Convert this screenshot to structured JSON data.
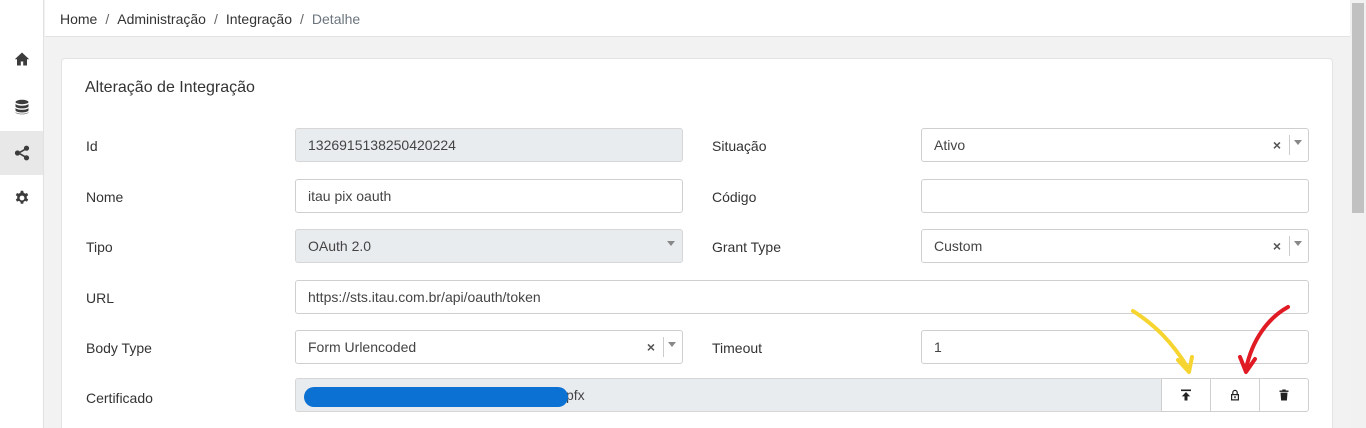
{
  "breadcrumb": {
    "home": "Home",
    "admin": "Administração",
    "integration": "Integração",
    "current": "Detalhe",
    "separator": "/"
  },
  "sidebar": {
    "items": [
      {
        "icon": "home-icon"
      },
      {
        "icon": "database-icon"
      },
      {
        "icon": "share-icon",
        "active": true
      },
      {
        "icon": "gear-icon"
      }
    ]
  },
  "form": {
    "title": "Alteração de Integração",
    "id": {
      "label": "Id",
      "value": "1326915138250420224"
    },
    "situacao": {
      "label": "Situação",
      "value": "Ativo",
      "clear": "×"
    },
    "nome": {
      "label": "Nome",
      "value": "itau pix oauth"
    },
    "codigo": {
      "label": "Código",
      "value": ""
    },
    "tipo": {
      "label": "Tipo",
      "value": "OAuth 2.0"
    },
    "grant_type": {
      "label": "Grant Type",
      "value": "Custom",
      "clear": "×"
    },
    "url": {
      "label": "URL",
      "value": "https://sts.itau.com.br/api/oauth/token"
    },
    "body_type": {
      "label": "Body Type",
      "value": "Form Urlencoded",
      "clear": "×"
    },
    "timeout": {
      "label": "Timeout",
      "value": "1"
    },
    "certificado": {
      "label": "Certificado",
      "value_suffix": "pfx"
    }
  },
  "colors": {
    "redaction": "#0b72d4",
    "arrow_yellow": "#f7d531",
    "arrow_red": "#e01b24"
  }
}
